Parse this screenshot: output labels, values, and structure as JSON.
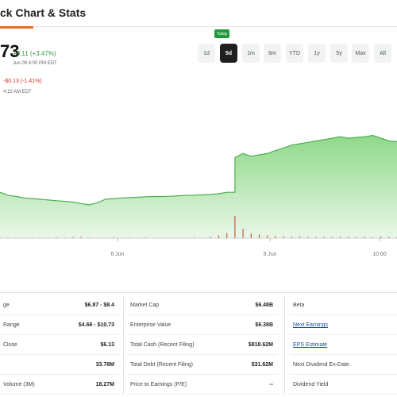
{
  "header": {
    "title": "ck Chart & Stats"
  },
  "quote": {
    "ticker": "73",
    "change_up": "+0.11 (+3.47%)",
    "time_up": "Jun 09 4:00 PM EDT",
    "change_down": "-$0.13 (-1.41%)",
    "time_down": "4:15 AM EDT"
  },
  "range": {
    "badge": "Today",
    "tabs": [
      "1d",
      "5d",
      "1m",
      "6m",
      "YTD",
      "1y",
      "5y",
      "Max",
      "All"
    ],
    "active_index": 1
  },
  "chart_data": {
    "type": "area",
    "title": "",
    "xlabel": "",
    "ylabel": "",
    "x_ticks": [
      "6 Jun",
      "9 Jun",
      "10:00"
    ],
    "series": [
      {
        "values": [
          9.8,
          9.6,
          9.5,
          9.4,
          9.35,
          9.3,
          9.25,
          9.2,
          9.15,
          9.1,
          9.0,
          8.9,
          9.05,
          9.3,
          9.35,
          9.4,
          9.42,
          9.45,
          9.48,
          9.5,
          9.5,
          9.52,
          9.55,
          9.58,
          9.6,
          9.62,
          9.65,
          9.7,
          9.8,
          12.3,
          12.6,
          12.4,
          12.5,
          12.6,
          12.8,
          13.0,
          13.2,
          13.3,
          13.4,
          13.5,
          13.6,
          13.7,
          13.8,
          13.7,
          13.75,
          13.8,
          13.9,
          13.7,
          13.5,
          13.45
        ]
      }
    ],
    "volume": [
      0.4,
      0.3,
      0.2,
      0.2,
      0.3,
      0.2,
      0.3,
      0.4,
      0.3,
      0.5,
      0.6,
      0.3,
      0.2,
      0.3,
      0.4,
      0.2,
      0.3,
      0.2,
      0.4,
      0.3,
      0.2,
      0.3,
      0.2,
      0.3,
      0.4,
      0.3,
      0.6,
      1.2,
      2.2,
      9.5,
      4.0,
      2.0,
      1.5,
      1.2,
      1.0,
      0.8,
      0.7,
      0.8,
      0.6,
      0.5,
      0.6,
      0.5,
      0.7,
      0.6,
      0.5,
      0.6,
      0.5,
      0.7,
      0.6,
      0.5
    ],
    "colors": {
      "line": "#4caf50",
      "fill_top": "#8fd98a",
      "fill_bottom": "#eaf7e8",
      "volume": "#c9583a"
    },
    "grid": false
  },
  "stats": {
    "col1": [
      {
        "label": "ge",
        "value": "$6.87 - $8.4"
      },
      {
        "label": "Range",
        "value": "$4.66 - $10.73"
      },
      {
        "label": "Close",
        "value": "$6.13"
      },
      {
        "label": "",
        "value": "33.78M"
      },
      {
        "label": "Volume (3M)",
        "value": "18.27M"
      }
    ],
    "col2": [
      {
        "label": "Market Cap",
        "value": "$6.48B"
      },
      {
        "label": "Enterprise Value",
        "value": "$6.38B"
      },
      {
        "label": "Total Cash (Recent Filing)",
        "value": "$818.62M"
      },
      {
        "label": "Total Debt (Recent Filing)",
        "value": "$31.62M"
      },
      {
        "label": "Price to Earnings (P/E)",
        "value": "--"
      }
    ],
    "col3": [
      {
        "label": "Beta",
        "value": ""
      },
      {
        "label": "Next Earnings",
        "value": ""
      },
      {
        "label": "EPS Estimate",
        "value": ""
      },
      {
        "label": "Next Dividend Ex-Date",
        "value": ""
      },
      {
        "label": "Dividend Yield",
        "value": ""
      }
    ]
  }
}
